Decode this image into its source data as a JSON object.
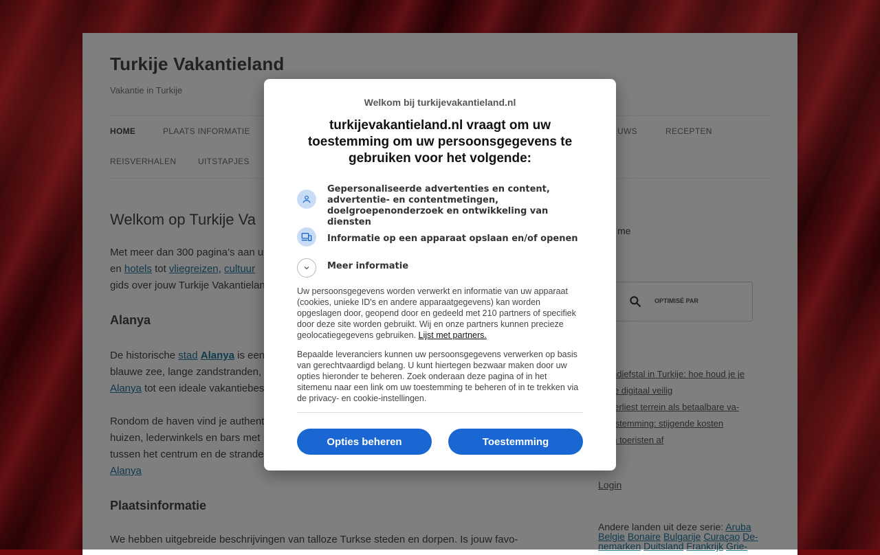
{
  "site": {
    "title": "Turkije Vakantieland",
    "description": "Vakantie in Turkije"
  },
  "nav": {
    "items": [
      "HOME",
      "PLAATS INFORMATIE",
      "UWS",
      "RECEPTEN",
      "REISVERHALEN",
      "UITSTAPJES"
    ]
  },
  "content": {
    "heading": "Welkom op Turkije Va",
    "intro_line1": "Met meer dan 300 pagina’s aan u",
    "intro_line2_prefix": "en",
    "intro_link_hotels": "hotels",
    "intro_line2_tot": "tot",
    "intro_link_vliegreizen": "vliegreizen",
    "intro_link_cultuur": "cultuur",
    "intro_line3": "gids over jouw Turkije Vakantielan",
    "section1": "Alanya",
    "alanya_line1_prefix": "De historische",
    "alanya_link_stad": "stad",
    "alanya_link_alanya": "Alanya",
    "alanya_line1_suffix": "is een",
    "alanya_line2": "blauwe zee, lange zandstranden,",
    "alanya_line3_link": "Alanya",
    "alanya_line3_suffix": "tot een ideale vakantiebes",
    "rondom_line1": "Rondom de haven vind je authent",
    "rondom_line2": "huizen, lederwinkels en bars met",
    "rondom_line3": "tussen het centrum en de strande",
    "rondom_line4_link": "Alanya",
    "section2": "Plaatsinformatie",
    "plaats_line1": "We hebben uitgebreide beschrijvingen van talloze Turkse steden en dorpen. Is jouw favo-"
  },
  "sidebar": {
    "home_fragment": "me",
    "search_label": "OPTIMISÉ PAR",
    "news1_line1": "foondiefstal in Turkije: hoe houd je je",
    "news1_line2": "antie digitaal veilig",
    "news2_line1": "ije verliest terrein als betaalbare va-",
    "news2_line2": "iebestemming: stijgende kosten",
    "news2_line3": "kken toeristen af",
    "login": "Login",
    "countries_label": "Andere landen uit deze serie:",
    "countries": [
      "Aruba",
      "Belgie",
      "Bonaire",
      "Bulgarije",
      "Curaçao",
      "De-",
      "nemarken",
      "Duitsland",
      "Frankrijk",
      "Grie-"
    ]
  },
  "consent": {
    "welcome": "Welkom bij turkijevakantieland.nl",
    "title": "turkijevakantieland.nl vraagt om uw toestemming om uw persoonsgegevens te gebruiken voor het volgende:",
    "purpose1": "Gepersonaliseerde advertenties en content, advertentie- en contentmetingen, doelgroepenonderzoek en ontwikkeling van diensten",
    "purpose2": "Informatie op een apparaat opslaan en/of openen",
    "more_info": "Meer informatie",
    "para1": "Uw persoonsgegevens worden verwerkt en informatie van uw apparaat (cookies, unieke ID's en andere apparaatgegevens) kan worden opgeslagen door, geopend door en gedeeld met 210 partners of specifiek door deze site worden gebruikt. Wij en onze partners kunnen precieze geolocatiegegevens gebruiken.",
    "partners_link": "Lijst met partners.",
    "para2": "Bepaalde leveranciers kunnen uw persoonsgegevens verwerken op basis van gerechtvaardigd belang. U kunt hiertegen bezwaar maken door uw opties hieronder te beheren. Zoek onderaan deze pagina of in het sitemenu naar een link om uw toestemming te beheren of in te trekken via de privacy- en cookie-instellingen.",
    "btn_manage": "Opties beheren",
    "btn_consent": "Toestemming"
  },
  "colors": {
    "link": "#21759b",
    "button": "#1a66d2",
    "icon_bg": "#c9dcf5"
  }
}
